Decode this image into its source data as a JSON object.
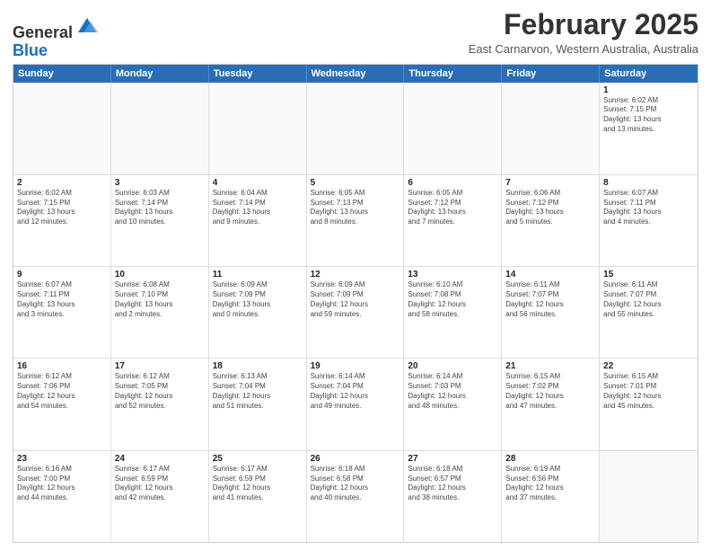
{
  "header": {
    "logo": {
      "line1": "General",
      "line2": "Blue"
    },
    "month": "February 2025",
    "location": "East Carnarvon, Western Australia, Australia"
  },
  "dayHeaders": [
    "Sunday",
    "Monday",
    "Tuesday",
    "Wednesday",
    "Thursday",
    "Friday",
    "Saturday"
  ],
  "weeks": [
    [
      {
        "date": "",
        "info": ""
      },
      {
        "date": "",
        "info": ""
      },
      {
        "date": "",
        "info": ""
      },
      {
        "date": "",
        "info": ""
      },
      {
        "date": "",
        "info": ""
      },
      {
        "date": "",
        "info": ""
      },
      {
        "date": "1",
        "info": "Sunrise: 6:02 AM\nSunset: 7:15 PM\nDaylight: 13 hours\nand 13 minutes."
      }
    ],
    [
      {
        "date": "2",
        "info": "Sunrise: 6:02 AM\nSunset: 7:15 PM\nDaylight: 13 hours\nand 12 minutes."
      },
      {
        "date": "3",
        "info": "Sunrise: 6:03 AM\nSunset: 7:14 PM\nDaylight: 13 hours\nand 10 minutes."
      },
      {
        "date": "4",
        "info": "Sunrise: 6:04 AM\nSunset: 7:14 PM\nDaylight: 13 hours\nand 9 minutes."
      },
      {
        "date": "5",
        "info": "Sunrise: 6:05 AM\nSunset: 7:13 PM\nDaylight: 13 hours\nand 8 minutes."
      },
      {
        "date": "6",
        "info": "Sunrise: 6:05 AM\nSunset: 7:12 PM\nDaylight: 13 hours\nand 7 minutes."
      },
      {
        "date": "7",
        "info": "Sunrise: 6:06 AM\nSunset: 7:12 PM\nDaylight: 13 hours\nand 5 minutes."
      },
      {
        "date": "8",
        "info": "Sunrise: 6:07 AM\nSunset: 7:11 PM\nDaylight: 13 hours\nand 4 minutes."
      }
    ],
    [
      {
        "date": "9",
        "info": "Sunrise: 6:07 AM\nSunset: 7:11 PM\nDaylight: 13 hours\nand 3 minutes."
      },
      {
        "date": "10",
        "info": "Sunrise: 6:08 AM\nSunset: 7:10 PM\nDaylight: 13 hours\nand 2 minutes."
      },
      {
        "date": "11",
        "info": "Sunrise: 6:09 AM\nSunset: 7:09 PM\nDaylight: 13 hours\nand 0 minutes."
      },
      {
        "date": "12",
        "info": "Sunrise: 6:09 AM\nSunset: 7:09 PM\nDaylight: 12 hours\nand 59 minutes."
      },
      {
        "date": "13",
        "info": "Sunrise: 6:10 AM\nSunset: 7:08 PM\nDaylight: 12 hours\nand 58 minutes."
      },
      {
        "date": "14",
        "info": "Sunrise: 6:11 AM\nSunset: 7:07 PM\nDaylight: 12 hours\nand 56 minutes."
      },
      {
        "date": "15",
        "info": "Sunrise: 6:11 AM\nSunset: 7:07 PM\nDaylight: 12 hours\nand 55 minutes."
      }
    ],
    [
      {
        "date": "16",
        "info": "Sunrise: 6:12 AM\nSunset: 7:06 PM\nDaylight: 12 hours\nand 54 minutes."
      },
      {
        "date": "17",
        "info": "Sunrise: 6:12 AM\nSunset: 7:05 PM\nDaylight: 12 hours\nand 52 minutes."
      },
      {
        "date": "18",
        "info": "Sunrise: 6:13 AM\nSunset: 7:04 PM\nDaylight: 12 hours\nand 51 minutes."
      },
      {
        "date": "19",
        "info": "Sunrise: 6:14 AM\nSunset: 7:04 PM\nDaylight: 12 hours\nand 49 minutes."
      },
      {
        "date": "20",
        "info": "Sunrise: 6:14 AM\nSunset: 7:03 PM\nDaylight: 12 hours\nand 48 minutes."
      },
      {
        "date": "21",
        "info": "Sunrise: 6:15 AM\nSunset: 7:02 PM\nDaylight: 12 hours\nand 47 minutes."
      },
      {
        "date": "22",
        "info": "Sunrise: 6:15 AM\nSunset: 7:01 PM\nDaylight: 12 hours\nand 45 minutes."
      }
    ],
    [
      {
        "date": "23",
        "info": "Sunrise: 6:16 AM\nSunset: 7:00 PM\nDaylight: 12 hours\nand 44 minutes."
      },
      {
        "date": "24",
        "info": "Sunrise: 6:17 AM\nSunset: 6:59 PM\nDaylight: 12 hours\nand 42 minutes."
      },
      {
        "date": "25",
        "info": "Sunrise: 6:17 AM\nSunset: 6:59 PM\nDaylight: 12 hours\nand 41 minutes."
      },
      {
        "date": "26",
        "info": "Sunrise: 6:18 AM\nSunset: 6:58 PM\nDaylight: 12 hours\nand 40 minutes."
      },
      {
        "date": "27",
        "info": "Sunrise: 6:18 AM\nSunset: 6:57 PM\nDaylight: 12 hours\nand 38 minutes."
      },
      {
        "date": "28",
        "info": "Sunrise: 6:19 AM\nSunset: 6:56 PM\nDaylight: 12 hours\nand 37 minutes."
      },
      {
        "date": "",
        "info": ""
      }
    ]
  ]
}
